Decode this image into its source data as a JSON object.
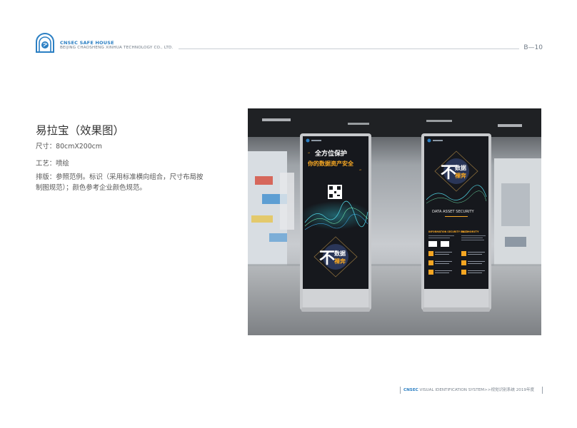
{
  "header": {
    "brand_name": "CNSEC SAFE HOUSE",
    "brand_sub": "BEIJING CHAOSHENG XINHUA TECHNOLOGY CO., LTD.",
    "page_number": "B—10"
  },
  "section": {
    "title": "易拉宝（效果图）",
    "size": "尺寸：80cmX200cm",
    "craft": "工艺：喷绘",
    "layout": "排版：参照范例。标识（采用标准横向组合，尺寸布局按制图规范）；颜色参考企业颜色规范。"
  },
  "poster_left": {
    "headline_line1": "全方位保护",
    "headline_line2": "你的数据资产安全",
    "emblem_char": "不",
    "emblem_line1": "数据",
    "emblem_line2": "裸奔"
  },
  "poster_right": {
    "emblem_char": "不",
    "emblem_line1": "数据",
    "emblem_line2": "裸奔",
    "caption": "DATA ASSET SECURITY",
    "col1_heading": "INFORMATION SECURITY FIELD",
    "col2_heading": "AUTHORITY"
  },
  "footer": {
    "brand": "CNSEC",
    "text": " VISUAL IDENTIFICATION SYSTEM>>视觉识别系统 2019年度"
  },
  "colors": {
    "brand_blue": "#2b7fc3",
    "poster_orange": "#f5a623",
    "poster_dark": "#16181d"
  }
}
